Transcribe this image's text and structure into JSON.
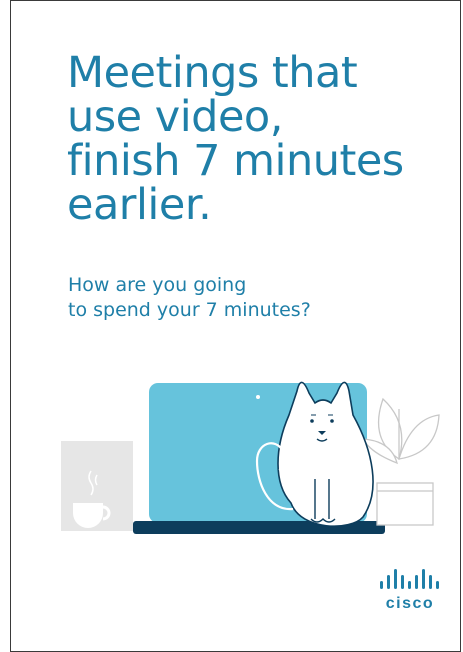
{
  "headline": {
    "lines": [
      "Meetings that",
      "use video,",
      "finish 7 minutes",
      "earlier."
    ]
  },
  "subheadline": {
    "lines": [
      "How are you going",
      "to spend your 7 minutes?"
    ]
  },
  "illustration": {
    "elements": [
      "coffee-cup-icon",
      "laptop-icon",
      "cat-illustration",
      "potted-plant-icon"
    ]
  },
  "logo": {
    "wordmark": "cisco"
  },
  "colors": {
    "text_blue": "#1f7fa8",
    "laptop_screen": "#66c3dc",
    "laptop_base": "#0d3d5c",
    "cup_gray": "#e6e6e6",
    "border": "#3a3a3a"
  }
}
